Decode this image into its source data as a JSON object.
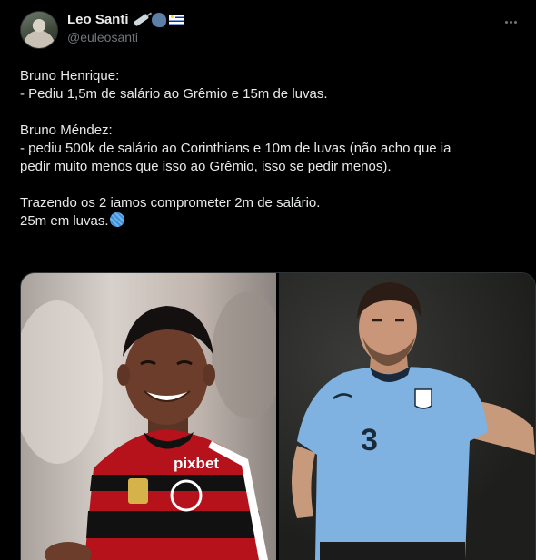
{
  "author": {
    "name": "Leo Santi",
    "handle": "@euleosanti",
    "emoji_icons": [
      "syringe-icon",
      "speaking-head-icon",
      "uruguay-flag-icon"
    ]
  },
  "tweet": {
    "p1_l1": "Bruno Henrique:",
    "p1_l2": "- Pediu 1,5m de salário ao Grêmio e 15m de luvas.",
    "p2_l1": "Bruno Méndez:",
    "p2_l2": "- pediu 500k de salário ao Corinthians e 10m de luvas (não acho que ia",
    "p2_l3": "pedir muito menos que isso ao Grêmio, isso se pedir menos).",
    "p3_l1": "Trazendo os 2 iamos comprometer 2m de salário.",
    "p3_l2": "25m em luvas.",
    "p3_emoji": "yarn-icon"
  },
  "photos": {
    "left_jersey_text": "pixbet",
    "right_jersey_number": "3"
  },
  "colors": {
    "background": "#000000",
    "text": "#e7e9ea",
    "secondary": "#71767b",
    "flamengo_red": "#c8102e",
    "uruguay_blue": "#7fb2e0"
  }
}
